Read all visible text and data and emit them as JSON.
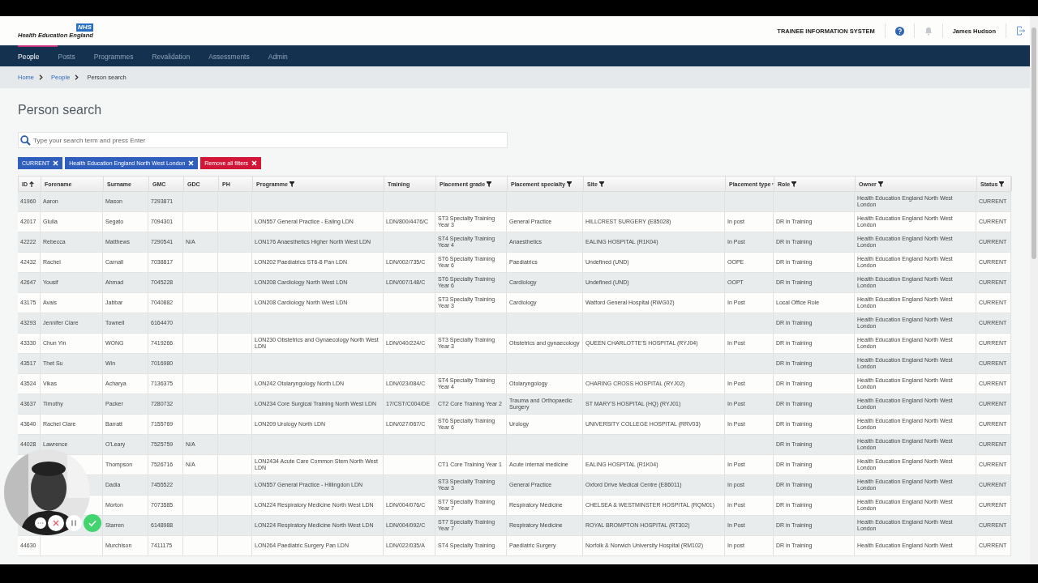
{
  "logo": {
    "badge": "NHS",
    "name": "Health Education England"
  },
  "header": {
    "system_name": "TRAINEE INFORMATION SYSTEM",
    "user": "James Hudson"
  },
  "nav": [
    {
      "label": "People",
      "selected": true
    },
    {
      "label": "Posts",
      "selected": false
    },
    {
      "label": "Programmes",
      "selected": false
    },
    {
      "label": "Revalidation",
      "selected": false
    },
    {
      "label": "Assessments",
      "selected": false
    },
    {
      "label": "Admin",
      "selected": false
    }
  ],
  "breadcrumbs": [
    "Home",
    "People",
    "Person search"
  ],
  "title": "Person search",
  "search": {
    "placeholder": "Type your search term and press Enter"
  },
  "filters": [
    {
      "label": "CURRENT",
      "kind": "filter"
    },
    {
      "label": "Health Education England North West London",
      "kind": "filter"
    },
    {
      "label": "Remove all filters",
      "kind": "clear"
    }
  ],
  "table": {
    "columns": [
      {
        "label": "ID",
        "sorted": true,
        "filter": false
      },
      {
        "label": "Forename",
        "sorted": false,
        "filter": false
      },
      {
        "label": "Surname",
        "sorted": false,
        "filter": false
      },
      {
        "label": "GMC",
        "sorted": false,
        "filter": false
      },
      {
        "label": "GDC",
        "sorted": false,
        "filter": false
      },
      {
        "label": "PH",
        "sorted": false,
        "filter": false
      },
      {
        "label": "Programme",
        "sorted": false,
        "filter": true
      },
      {
        "label": "Training",
        "sorted": false,
        "filter": false
      },
      {
        "label": "Placement grade",
        "sorted": false,
        "filter": true
      },
      {
        "label": "Placement specialty",
        "sorted": false,
        "filter": true
      },
      {
        "label": "Site",
        "sorted": false,
        "filter": true
      },
      {
        "label": "Placement type",
        "sorted": false,
        "filter": true
      },
      {
        "label": "Role",
        "sorted": false,
        "filter": true
      },
      {
        "label": "Owner",
        "sorted": false,
        "filter": true
      },
      {
        "label": "Status",
        "sorted": false,
        "filter": true
      }
    ],
    "rows": [
      [
        "41960",
        "Aaron",
        "Mason",
        "7293871",
        null,
        null,
        null,
        null,
        null,
        null,
        null,
        null,
        null,
        "Health Education England North West London",
        "CURRENT"
      ],
      [
        "42017",
        "Giulia",
        "Segato",
        "7094301",
        null,
        null,
        "LON557 General Practice - Ealing LDN",
        "LDN/800/4476/C",
        "ST3 Specialty Training Year 3",
        "General Practice",
        "HILLCREST SURGERY (E85028)",
        "In post",
        "DR in Training",
        "Health Education England North West London",
        "CURRENT"
      ],
      [
        "42222",
        "Rebecca",
        "Matthews",
        "7290541",
        "N/A",
        null,
        "LON176 Anaesthetics Higher North West LDN",
        null,
        "ST4 Specialty Training Year 4",
        "Anaesthetics",
        "EALING HOSPITAL (R1K04)",
        "In Post",
        "DR in Training",
        "Health Education England North West London",
        "CURRENT"
      ],
      [
        "42432",
        "Rachel",
        "Carnall",
        "7038817",
        null,
        null,
        "LON202 Paediatrics ST6-8 Pan LDN",
        "LDN/002/735/C",
        "ST6 Specialty Training Year 6",
        "Paediatrics",
        "Undefined (UND)",
        "OOPE",
        "DR in Training",
        "Health Education England North West London",
        "CURRENT"
      ],
      [
        "42647",
        "Yousif",
        "Ahmad",
        "7045228",
        null,
        null,
        "LON208 Cardiology North West LDN",
        "LDN/007/148/C",
        "ST6 Specialty Training Year 6",
        "Cardiology",
        "Undefined (UND)",
        "OOPT",
        "DR in Training",
        "Health Education England North West London",
        "CURRENT"
      ],
      [
        "43175",
        "Avais",
        "Jabbar",
        "7040882",
        null,
        null,
        "LON208 Cardiology North West LDN",
        null,
        "ST3 Specialty Training Year 3",
        "Cardiology",
        "Watford General Hospital (RWG02)",
        "In Post",
        "Local Office Role",
        "Health Education England North West London",
        "CURRENT"
      ],
      [
        "43293",
        "Jennifer Clare",
        "Townell",
        "6164470",
        null,
        null,
        null,
        null,
        null,
        null,
        null,
        null,
        "DR in Training",
        "Health Education England North West London",
        "CURRENT"
      ],
      [
        "43330",
        "Chun Yin",
        "WONG",
        "7419266",
        null,
        null,
        "LON230 Obstetrics and Gynaecology North West LDN",
        "LDN/040/224/C",
        "ST3 Specialty Training Year 3",
        "Obstetrics and gynaecology",
        "QUEEN CHARLOTTE'S HOSPITAL (RYJ04)",
        "In Post",
        "DR in Training",
        "Health Education England North West London",
        "CURRENT"
      ],
      [
        "43517",
        "Thet Su",
        "Win",
        "7016980",
        null,
        null,
        null,
        null,
        null,
        null,
        null,
        null,
        "DR in Training",
        "Health Education England North West London",
        "CURRENT"
      ],
      [
        "43524",
        "Vikas",
        "Acharya",
        "7136375",
        null,
        null,
        "LON242 Otolaryngology North LDN",
        "LDN/023/084/C",
        "ST4 Specialty Training Year 4",
        "Otolaryngology",
        "CHARING CROSS HOSPITAL (RYJ02)",
        "In Post",
        "DR in Training",
        "Health Education England North West London",
        "CURRENT"
      ],
      [
        "43637",
        "Timothy",
        "Packer",
        "7280732",
        null,
        null,
        "LON234 Core Surgical Training North West LDN",
        "17/CST/C004/DE",
        "CT2 Core Training Year 2",
        "Trauma and Orthopaedic Surgery",
        "ST MARY'S HOSPITAL (HQ) (RYJ01)",
        "In Post",
        "DR in Training",
        "Health Education England North West London",
        "CURRENT"
      ],
      [
        "43640",
        "Rachel Clare",
        "Barratt",
        "7155769",
        null,
        null,
        "LON209 Urology North LDN",
        "LDN/027/067/C",
        "ST6 Specialty Training Year 6",
        "Urology",
        "UNIVERSITY COLLEGE HOSPITAL (RRV03)",
        "In Post",
        "DR in Training",
        "Health Education England North West London",
        "CURRENT"
      ],
      [
        "44028",
        "Lawrence",
        "O'Leary",
        "7525759",
        "N/A",
        null,
        null,
        null,
        null,
        null,
        null,
        null,
        "DR in Training",
        "Health Education England North West London",
        "CURRENT"
      ],
      [
        null,
        null,
        "Thompson",
        "7526716",
        "N/A",
        null,
        "LON2434 Acute Care Common Stem North West LDN",
        null,
        "CT1 Core Training Year 1",
        "Acute internal medicine",
        "EALING HOSPITAL (R1K04)",
        "In Post",
        "DR in Training",
        "Health Education England North West London",
        "CURRENT"
      ],
      [
        null,
        null,
        "Dadia",
        "7455522",
        null,
        null,
        "LON557 General Practice - Hillingdon LDN",
        null,
        "ST3 Specialty Training Year 3",
        "General Practice",
        "Oxford Drive Medical Centre (E86011)",
        "In post",
        "DR in Training",
        "Health Education England North West London",
        "CURRENT"
      ],
      [
        null,
        null,
        "Morton",
        "7073585",
        null,
        null,
        "LON224 Respiratory Medicine North West LDN",
        "LDN/004/076/C",
        "ST7 Specialty Training Year 7",
        "Respiratory Medicine",
        "CHELSEA & WESTMINSTER HOSPITAL (RQM01)",
        "In Post",
        "DR in Training",
        "Health Education England North West London",
        "CURRENT"
      ],
      [
        null,
        null,
        "Starren",
        "6148988",
        null,
        null,
        "LON224 Respiratory Medicine North West LDN",
        "LDN/004/092/C",
        "ST7 Specialty Training Year 7",
        "Respiratory Medicine",
        "ROYAL BROMPTON HOSPITAL (RT302)",
        "In Post",
        "DR in Training",
        "Health Education England North West London",
        "CURRENT"
      ],
      [
        "44630",
        null,
        "Murchison",
        "7411175",
        null,
        null,
        "LON264 Paediatric Surgery Pan LDN",
        "LDN/022/035/A",
        "ST4 Specialty Training",
        "Paediatric Surgery",
        "Norfolk & Norwich University Hospital (RM102)",
        "In post",
        "DR in Training",
        "Health Education England North West",
        "CURRENT"
      ]
    ]
  }
}
